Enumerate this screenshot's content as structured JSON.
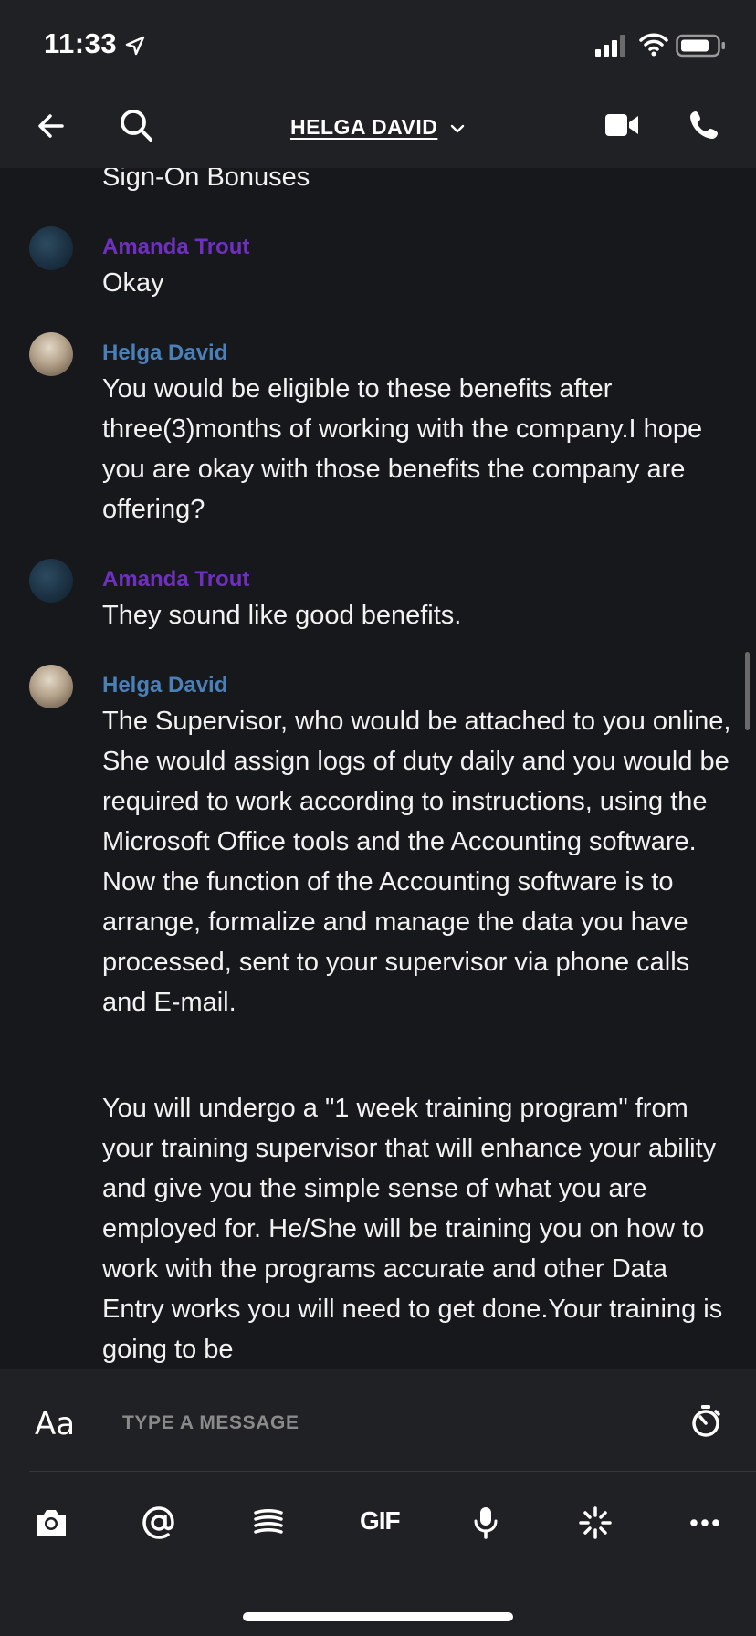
{
  "status_bar": {
    "time": "11:33"
  },
  "header": {
    "title": "HELGA DAVID"
  },
  "messages": [
    {
      "type": "text",
      "text": "Sign-On Bonuses"
    },
    {
      "type": "sender",
      "name": "Amanda Trout",
      "color": "#6f2fbf"
    },
    {
      "type": "text",
      "text": "Okay"
    },
    {
      "type": "sender",
      "name": "Helga David",
      "color": "#4b7fb8"
    },
    {
      "type": "text",
      "text": "You would be eligible to these benefits after three(3)months of working with the company.I hope you are okay with those benefits the company are offering?"
    },
    {
      "type": "sender",
      "name": "Amanda Trout",
      "color": "#6f2fbf"
    },
    {
      "type": "text",
      "text": "They sound like good benefits."
    },
    {
      "type": "sender",
      "name": "Helga David",
      "color": "#4b7fb8"
    },
    {
      "type": "text",
      "text": "The Supervisor, who would be attached to you online, She would assign logs of duty daily and you would be required to work according to instructions, using the Microsoft Office tools and the Accounting software. Now the function of the Accounting software is to arrange, formalize and manage the data you have processed, sent to your supervisor via phone calls and E-mail."
    },
    {
      "type": "text",
      "text": "You will undergo a \"1 week training program\" from your training supervisor that will enhance your ability and give you the simple sense of what you are employed for. He/She will be training you on how to work with the programs accurate and other Data Entry works you will need to get done.Your training is going to be"
    }
  ],
  "composer": {
    "aa_label": "Aa",
    "placeholder": "TYPE A MESSAGE",
    "gif_label": "GIF"
  },
  "icons": [
    "location-arrow-icon",
    "signal-icon",
    "wifi-icon",
    "battery-icon",
    "back-arrow-icon",
    "search-icon",
    "chevron-down-icon",
    "video-camera-icon",
    "phone-icon",
    "text-format-icon",
    "timer-icon",
    "camera-icon",
    "mention-icon",
    "audio-wave-icon",
    "gif-icon",
    "microphone-icon",
    "sparkle-icon",
    "more-icon"
  ]
}
